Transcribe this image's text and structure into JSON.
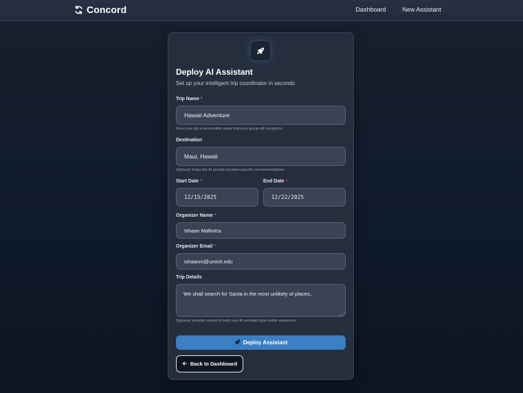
{
  "brand": {
    "name": "Concord",
    "icon": "sync-arrows-icon"
  },
  "nav": {
    "links": [
      "Dashboard",
      "New Assistant"
    ]
  },
  "form": {
    "header_icon": "rocket-icon",
    "title": "Deploy AI Assistant",
    "subtitle": "Set up your intelligent trip coordinator in seconds",
    "required_marker": "*",
    "trip_name": {
      "label": "Trip Name",
      "value": "Hawaii Adventure",
      "help": "Give your trip a memorable name that your group will recognize"
    },
    "destination": {
      "label": "Destination",
      "value": "Maui, Hawaii",
      "help": "Optional: helps the AI provide location-specific recommendations"
    },
    "start_date": {
      "label": "Start Date",
      "value": "12/15/2025"
    },
    "end_date": {
      "label": "End Date",
      "value": "12/22/2025"
    },
    "organizer_name": {
      "label": "Organizer Name",
      "value": "Ishaan Malhotra"
    },
    "organizer_email": {
      "label": "Organizer Email",
      "value": "ishaanm@umich.edu"
    },
    "trip_details": {
      "label": "Trip Details",
      "value": "We shall search for Santa in the most unlikely of places..",
      "help": "Optional: provide context to help your AI assistant give better responses"
    },
    "deploy_button": {
      "label": "Deploy Assistant",
      "icon": "rocket-icon"
    },
    "back_button": {
      "label": "Back to Dashboard",
      "icon": "arrow-left-icon"
    }
  },
  "colors": {
    "accent": "#3a7fc4",
    "required": "#e05a6a",
    "card": "#252e3d",
    "background": "#0f1a2b"
  }
}
